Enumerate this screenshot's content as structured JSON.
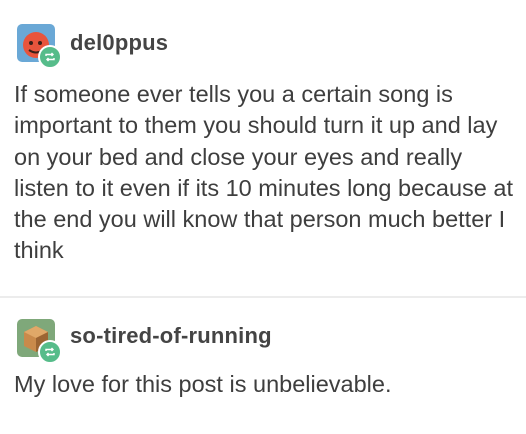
{
  "posts": [
    {
      "username": "del0ppus",
      "avatar_icon": "orange-face-avatar-icon",
      "badge_icon": "reblog-icon",
      "body": "If someone ever tells you a certain song is important to them you should turn it up and lay on your bed and close your eyes and really listen to it even if its 10 minutes long because at the end you will know that person much better I think"
    },
    {
      "username": "so-tired-of-running",
      "avatar_icon": "cube-avatar-icon",
      "badge_icon": "reblog-icon",
      "body": "My love for this post is unbelievable."
    }
  ],
  "colors": {
    "badge": "#56bc8a",
    "avatar1_bg": "#6aa8d6",
    "avatar1_face": "#e8543c",
    "avatar2_bg": "#7fa87a",
    "avatar2_cube": "#c98a4b"
  }
}
